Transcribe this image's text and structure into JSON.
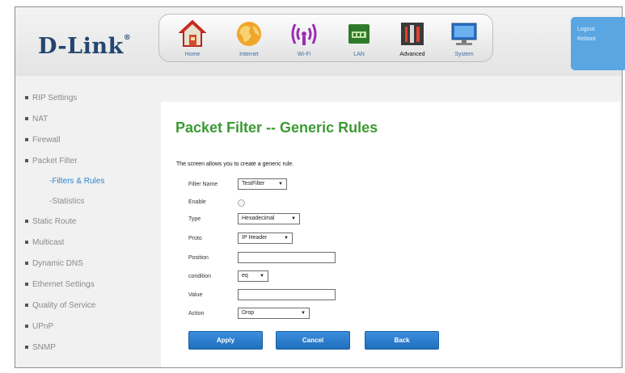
{
  "brand": {
    "logo_text": "D-Link"
  },
  "nav": [
    {
      "label": "Home",
      "icon": "home-icon"
    },
    {
      "label": "Internet",
      "icon": "globe-icon"
    },
    {
      "label": "Wi-Fi",
      "icon": "wifi-icon"
    },
    {
      "label": "LAN",
      "icon": "lan-icon"
    },
    {
      "label": "Advanced",
      "icon": "advanced-tools-icon"
    },
    {
      "label": "System",
      "icon": "system-monitor-icon"
    }
  ],
  "session": {
    "logout": "Logout",
    "reboot": "Reboot"
  },
  "sidebar": {
    "items": [
      {
        "label": "RIP Settings"
      },
      {
        "label": "NAT"
      },
      {
        "label": "Firewall"
      },
      {
        "label": "Packet Filter"
      },
      {
        "label": "-Filters & Rules"
      },
      {
        "label": "-Statistics"
      },
      {
        "label": "Static Route"
      },
      {
        "label": "Multicast"
      },
      {
        "label": "Dynamic DNS"
      },
      {
        "label": "Ethernet Settings"
      },
      {
        "label": "Quality of Service"
      },
      {
        "label": "UPnP"
      },
      {
        "label": "SNMP"
      }
    ]
  },
  "page": {
    "title": "Packet Filter -- Generic Rules",
    "intro": "The screen allows you to create a generic rule."
  },
  "form": {
    "filter_name": {
      "label": "Filter Name",
      "value": "TestFilter"
    },
    "enable": {
      "label": "Enable"
    },
    "type": {
      "label": "Type",
      "value": "Hexadecimal"
    },
    "proto": {
      "label": "Proto",
      "value": "IP Header"
    },
    "position": {
      "label": "Position",
      "value": ""
    },
    "condition": {
      "label": "condition",
      "value": "eq"
    },
    "value": {
      "label": "Value",
      "value": ""
    },
    "action": {
      "label": "Action",
      "value": "Drop"
    }
  },
  "buttons": {
    "apply": "Apply",
    "cancel": "Cancel",
    "back": "Back"
  },
  "colors": {
    "accent_green": "#3b9a34",
    "button_blue": "#2a7fcf",
    "link_blue": "#2b86d1"
  }
}
